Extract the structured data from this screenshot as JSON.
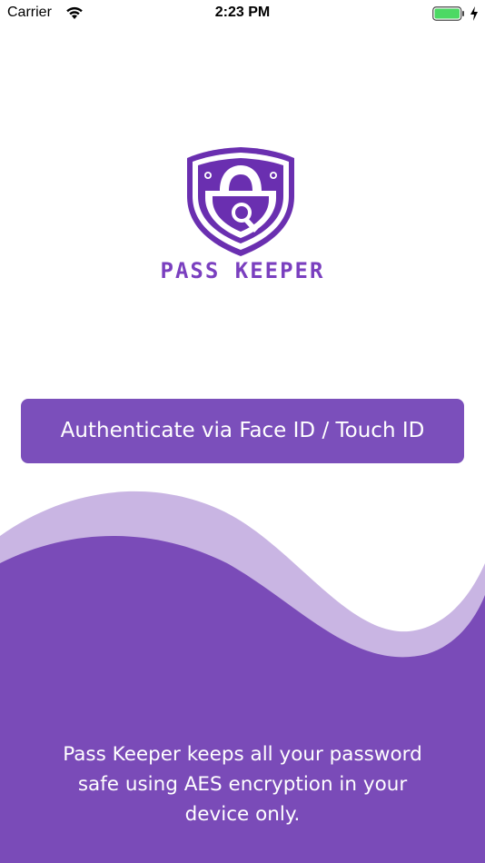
{
  "status_bar": {
    "carrier": "Carrier",
    "time": "2:23 PM",
    "wifi_icon": "wifi-icon",
    "battery_icon": "battery-icon",
    "charging_icon": "charging-icon"
  },
  "logo": {
    "icon": "shield-lock-icon",
    "text": "PASS KEEPER"
  },
  "auth_button": {
    "label": "Authenticate via Face ID / Touch ID"
  },
  "footer": {
    "line1": "Pass Keeper keeps all your password",
    "line2": "safe using AES encryption in your",
    "line3": "device only."
  },
  "colors": {
    "primary": "#7b4fbb",
    "wave_light": "#c7b2e2",
    "wave_dark": "#7a4bb8",
    "logo": "#6a2fb0",
    "battery": "#4cd964"
  }
}
